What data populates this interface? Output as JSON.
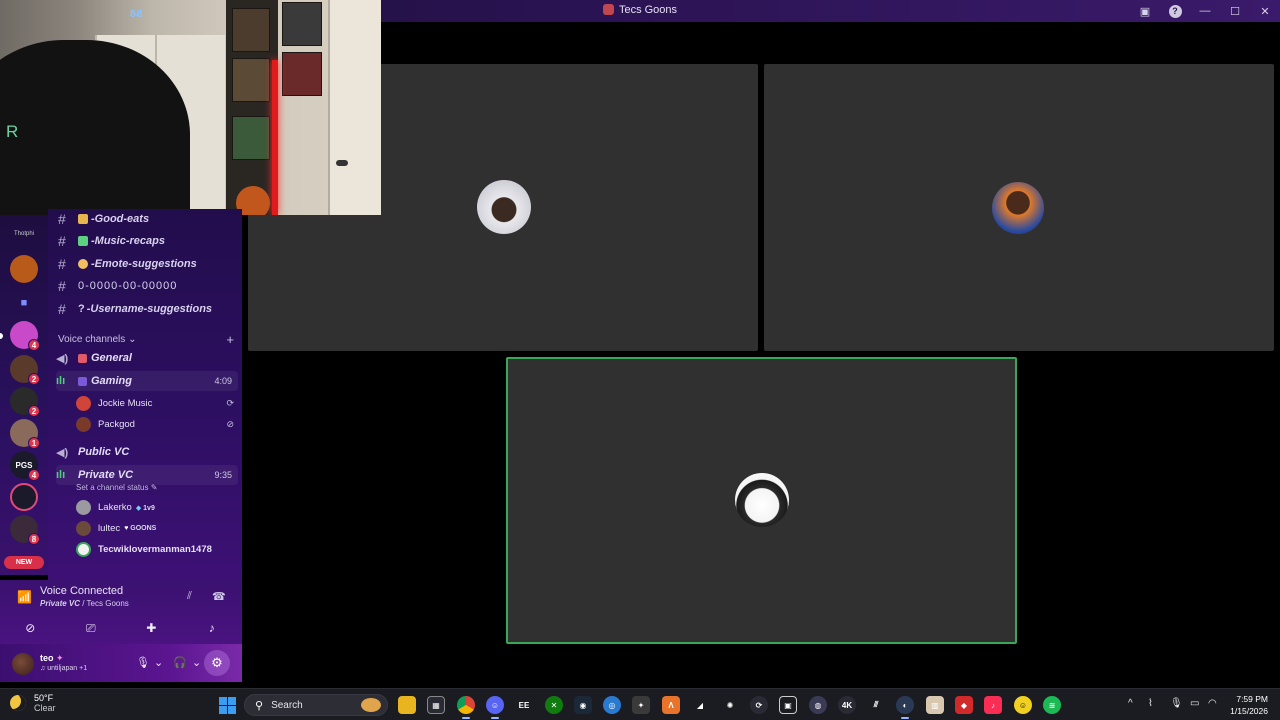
{
  "window": {
    "title": "Tecs Goons"
  },
  "webcam": {
    "overlay_tag": "8-8",
    "letter": "R"
  },
  "channels": {
    "text": [
      {
        "label": "-Good-eats",
        "color": "#e8b64c"
      },
      {
        "label": "-Music-recaps",
        "color": "#5ed081"
      },
      {
        "label": "-Emote-suggestions",
        "color": "#f0c060"
      },
      {
        "label": "0-0000-00-00000",
        "color": ""
      },
      {
        "label": "-Username-suggestions",
        "color": "",
        "prefix": "?"
      }
    ],
    "voice_header": "Voice channels",
    "voice": {
      "general": "General",
      "gaming": "Gaming",
      "gaming_timer": "4:09",
      "public": "Public VC",
      "private": "Private VC",
      "private_timer": "9:35",
      "set_status": "Set a channel status"
    },
    "gaming_members": [
      {
        "name": "Jockie Music"
      },
      {
        "name": "Packgod"
      }
    ],
    "private_members": [
      {
        "name": "Lakerko",
        "tag": "1v9"
      },
      {
        "name": "lultec",
        "tag": "GOONS"
      },
      {
        "name": "Tecwiklovermanman1478",
        "tag": ""
      }
    ]
  },
  "rail": {
    "top_label": "Thotphi",
    "badges": [
      "4",
      "2",
      "2",
      "1",
      "4",
      "8"
    ],
    "new_label": "NEW"
  },
  "voice_panel": {
    "status": "Voice Connected",
    "channel": "Private VC",
    "server": " / Tecs Goons"
  },
  "user": {
    "name": "teo",
    "status": "untiljapan +1"
  },
  "taskbar": {
    "temp": "50°F",
    "condition": "Clear",
    "search_placeholder": "Search",
    "time": "7:59 PM",
    "date": "1/15/2026"
  },
  "colors": {
    "accent_green": "#3ca55c",
    "tile_bg": "#303030",
    "sidebar_purple": "#2d0f62"
  }
}
